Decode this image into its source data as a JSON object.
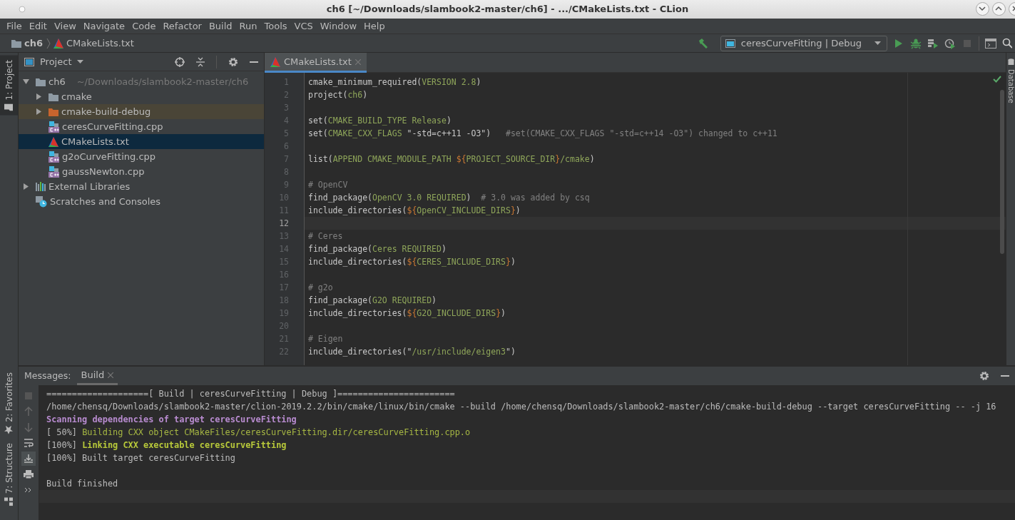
{
  "window": {
    "title": "ch6 [~/Downloads/slambook2-master/ch6] - .../CMakeLists.txt - CLion"
  },
  "menu": [
    {
      "label": "File"
    },
    {
      "label": "Edit"
    },
    {
      "label": "View"
    },
    {
      "label": "Navigate"
    },
    {
      "label": "Code"
    },
    {
      "label": "Refactor"
    },
    {
      "label": "Build"
    },
    {
      "label": "Run"
    },
    {
      "label": "Tools"
    },
    {
      "label": "VCS"
    },
    {
      "label": "Window"
    },
    {
      "label": "Help"
    }
  ],
  "breadcrumbs": [
    {
      "label": "ch6",
      "kind": "folder"
    },
    {
      "label": "CMakeLists.txt",
      "kind": "cmake"
    }
  ],
  "run_configuration": "ceresCurveFitting | Debug",
  "side_tabs": [
    {
      "label": "1: Project",
      "kind": "project",
      "selected": true
    },
    {
      "label": "2: Favorites",
      "kind": "favorites",
      "selected": false
    },
    {
      "label": "7: Structure",
      "kind": "structure",
      "selected": false
    }
  ],
  "right_tabs": [
    {
      "label": "Database"
    }
  ],
  "project_panel": {
    "title": "Project",
    "tree": [
      {
        "label": "ch6",
        "path": "~/Downloads/slambook2-master/ch6",
        "kind": "module",
        "expanded": true,
        "selected": false,
        "children": [
          {
            "label": "cmake",
            "kind": "folder",
            "expanded": false,
            "selected": false
          },
          {
            "label": "cmake-build-debug",
            "kind": "excluded",
            "expanded": false,
            "selected": false
          },
          {
            "label": "ceresCurveFitting.cpp",
            "kind": "cpp",
            "selected": false
          },
          {
            "label": "CMakeLists.txt",
            "kind": "cmake",
            "selected": true
          },
          {
            "label": "g2oCurveFitting.cpp",
            "kind": "cpp",
            "selected": false
          },
          {
            "label": "gaussNewton.cpp",
            "kind": "cpp",
            "selected": false
          }
        ]
      },
      {
        "label": "External Libraries",
        "kind": "libraries",
        "expanded": false,
        "selected": false
      },
      {
        "label": "Scratches and Consoles",
        "kind": "scratches",
        "selected": false
      }
    ]
  },
  "editor": {
    "tabs": [
      {
        "label": "CMakeLists.txt",
        "selected": true
      }
    ],
    "lines": [
      {
        "number": "1",
        "current": false,
        "text": "cmake_minimum_required(VERSION 2.8)"
      },
      {
        "number": "2",
        "current": false,
        "text": "project(ch6)"
      },
      {
        "number": "3",
        "current": false
      },
      {
        "number": "4",
        "current": false,
        "text": "set(CMAKE_BUILD_TYPE Release)"
      },
      {
        "number": "5",
        "current": false,
        "text": "set(CMAKE_CXX_FLAGS \"-std=c++11 -O3\")   #set(CMAKE_CXX_FLAGS \"-std=c++14 -O3\") changed to c++11"
      },
      {
        "number": "6",
        "current": false
      },
      {
        "number": "7",
        "current": false,
        "text": "list(APPEND CMAKE_MODULE_PATH ${PROJECT_SOURCE_DIR}/cmake)"
      },
      {
        "number": "8",
        "current": false
      },
      {
        "number": "9",
        "current": false,
        "text": "# OpenCV"
      },
      {
        "number": "10",
        "current": false,
        "text": "find_package(OpenCV 3.0 REQUIRED)  # 3.0 was added by csq"
      },
      {
        "number": "11",
        "current": false,
        "text": "include_directories(${OpenCV_INCLUDE_DIRS})"
      },
      {
        "number": "12",
        "current": true
      },
      {
        "number": "13",
        "current": false,
        "text": "# Ceres"
      },
      {
        "number": "14",
        "current": false,
        "text": "find_package(Ceres REQUIRED)"
      },
      {
        "number": "15",
        "current": false,
        "text": "include_directories(${CERES_INCLUDE_DIRS})"
      },
      {
        "number": "16",
        "current": false
      },
      {
        "number": "17",
        "current": false,
        "text": "# g2o"
      },
      {
        "number": "18",
        "current": false,
        "text": "find_package(G2O REQUIRED)"
      },
      {
        "number": "19",
        "current": false,
        "text": "include_directories(${G2O_INCLUDE_DIRS})"
      },
      {
        "number": "20",
        "current": false
      },
      {
        "number": "21",
        "current": false,
        "text": "# Eigen"
      },
      {
        "number": "22",
        "current": false,
        "text": "include_directories(\"/usr/include/eigen3\")"
      }
    ]
  },
  "messages": {
    "label": "Messages:",
    "tabs": [
      {
        "label": "Build",
        "selected": true
      }
    ],
    "lines": [
      {
        "kind": "plain",
        "text": "====================[ Build | ceresCurveFitting | Debug ]======================="
      },
      {
        "kind": "plain",
        "text": "/home/chensq/Downloads/slambook2-master/clion-2019.2.2/bin/cmake/linux/bin/cmake --build /home/chensq/Downloads/slambook2-master/ch6/cmake-build-debug --target ceresCurveFitting -- -j 16"
      },
      {
        "kind": "scan",
        "text": "Scanning dependencies of target ceresCurveFitting"
      },
      {
        "kind": "progress",
        "text": "[ 50%] Building CXX object CMakeFiles/ceresCurveFitting.dir/ceresCurveFitting.cpp.o"
      },
      {
        "kind": "link",
        "text": "[100%] Linking CXX executable ceresCurveFitting"
      },
      {
        "kind": "plain",
        "text": "[100%] Built target ceresCurveFitting"
      },
      {
        "kind": "finished",
        "text": "Build finished"
      }
    ]
  }
}
